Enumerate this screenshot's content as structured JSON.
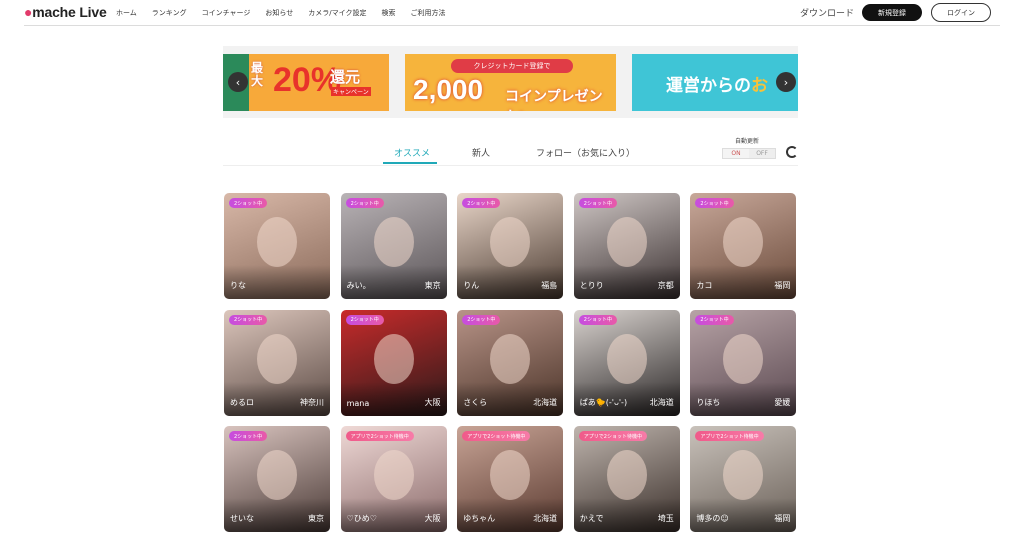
{
  "header": {
    "logo": "mache Live",
    "nav": [
      "ホーム",
      "ランキング",
      "コインチャージ",
      "お知らせ",
      "カメラ/マイク設定",
      "検索",
      "ご利用方法"
    ],
    "download": "ダウンロード",
    "signup": "新規登録",
    "login": "ログイン"
  },
  "banners": [
    {
      "line1": "最",
      "line2": "大",
      "big": "20%",
      "sub": "還元",
      "tag": "キャンペーン"
    },
    {
      "pill": "クレジットカード登録で",
      "big": "2,000",
      "sub": "コインプレゼント!"
    },
    {
      "text": "運営からの",
      "highlight": "お"
    }
  ],
  "tabs": [
    "オススメ",
    "新人",
    "フォロー（お気に入り）"
  ],
  "auto_update": {
    "label": "自動更新",
    "on": "ON",
    "off": "OFF"
  },
  "icons": {
    "prev": "chevron-left-icon",
    "next": "chevron-right-icon",
    "refresh": "refresh-icon"
  },
  "colors": {
    "accent": "#20a9b8",
    "badge": "#c64de0",
    "signup_bg": "#111111"
  },
  "cards": [
    {
      "badge": "2ショット中",
      "name": "りな",
      "area": ""
    },
    {
      "badge": "2ショット中",
      "name": "みい。",
      "area": "東京"
    },
    {
      "badge": "2ショット中",
      "name": "りん",
      "area": "福島"
    },
    {
      "badge": "2ショット中",
      "name": "とりり",
      "area": "京都"
    },
    {
      "badge": "2ショット中",
      "name": "カコ",
      "area": "福岡"
    },
    {
      "badge": "2ショット中",
      "name": "めるロ",
      "area": "神奈川"
    },
    {
      "badge": "2ショット中",
      "name": "mana",
      "area": "大阪"
    },
    {
      "badge": "2ショット中",
      "name": "さくら",
      "area": "北海道"
    },
    {
      "badge": "2ショット中",
      "name": "ぱあ🐤(-'ᴗ'-)",
      "area": "北海道"
    },
    {
      "badge": "2ショット中",
      "name": "りほち",
      "area": "愛媛"
    },
    {
      "badge": "2ショット中",
      "name": "せいな",
      "area": "東京"
    },
    {
      "badge": "アプリで2ショット待機中",
      "name": "♡ひめ♡",
      "area": "大阪"
    },
    {
      "badge": "アプリで2ショット待機中",
      "name": "ゆちゃん",
      "area": "北海道"
    },
    {
      "badge": "アプリで2ショット待機中",
      "name": "かえで",
      "area": "埼玉"
    },
    {
      "badge": "アプリで2ショット待機中",
      "name": "博多の☺",
      "area": "福岡"
    }
  ]
}
